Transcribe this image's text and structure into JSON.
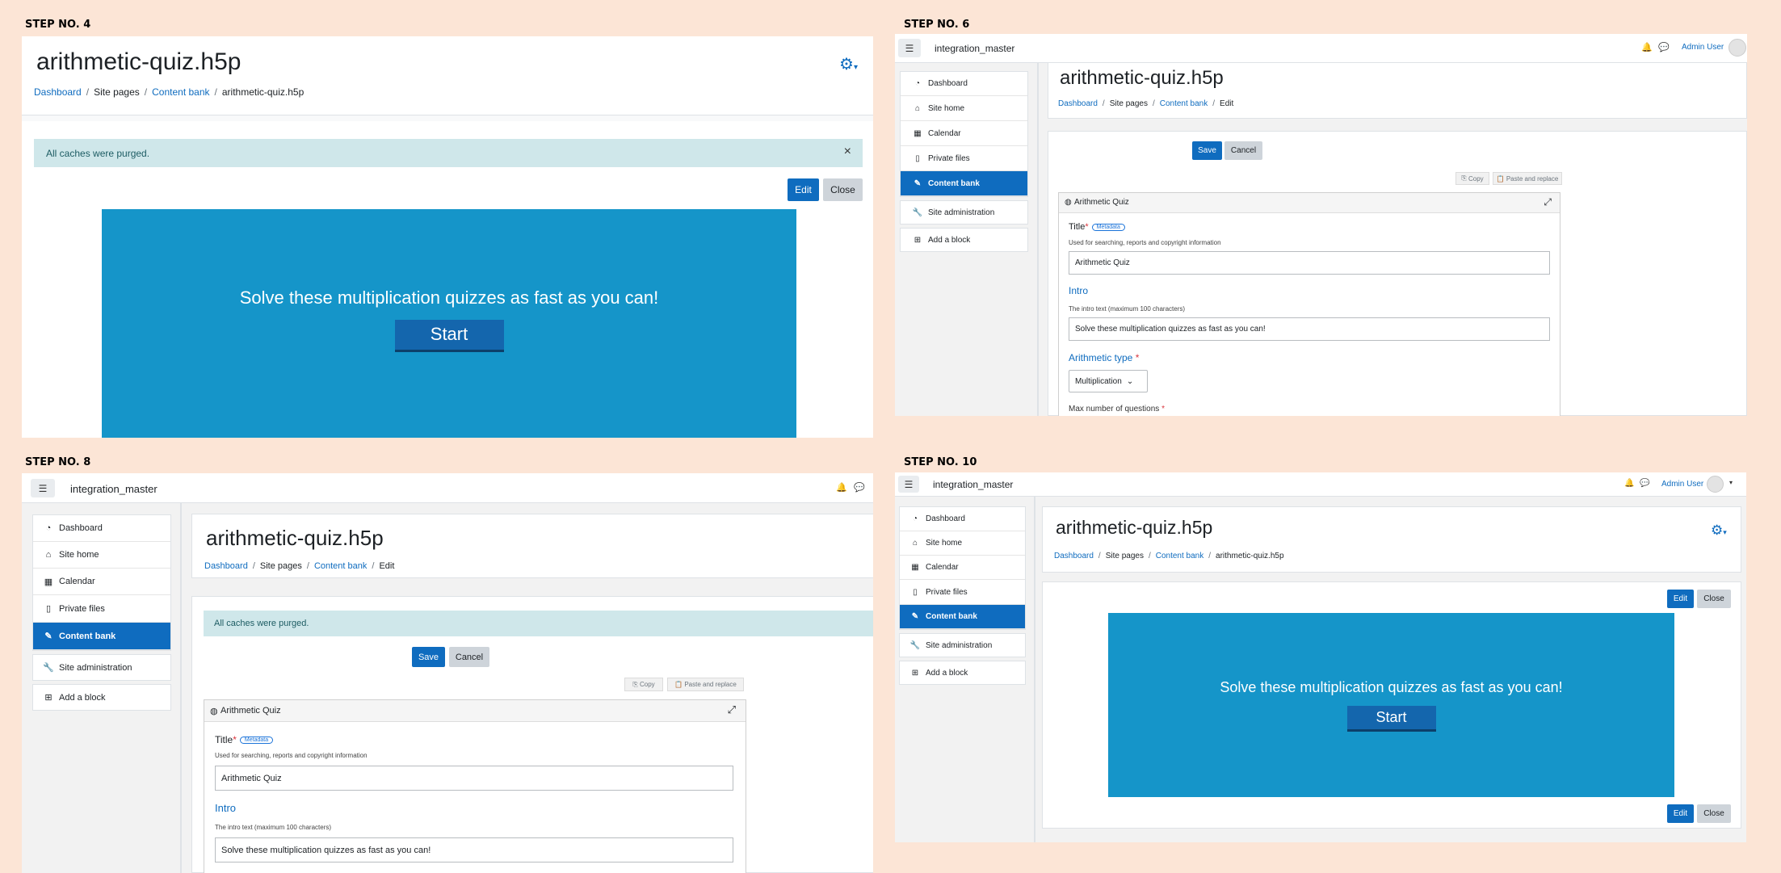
{
  "steps": [
    {
      "label": "STEP NO. 4"
    },
    {
      "label": "STEP NO. 6"
    },
    {
      "label": "STEP NO. 8"
    },
    {
      "label": "STEP NO. 10"
    }
  ],
  "common": {
    "site_name": "integration_master",
    "user_name": "Admin User",
    "page_title": "arithmetic-quiz.h5p",
    "breadcrumb_view": [
      "Dashboard",
      "Site pages",
      "Content bank",
      "arithmetic-quiz.h5p"
    ],
    "breadcrumb_edit": [
      "Dashboard",
      "Site pages",
      "Content bank",
      "Edit"
    ],
    "alert": "All caches were purged.",
    "close_symbol": "×",
    "edit_label": "Edit",
    "close_label": "Close",
    "save_label": "Save",
    "cancel_label": "Cancel",
    "copy_label": "Copy",
    "paste_label": "Paste and replace",
    "h5p_text": "Solve these multiplication quizzes as fast as you can!",
    "h5p_start": "Start",
    "nav": [
      "Dashboard",
      "Site home",
      "Calendar",
      "Private files",
      "Content bank",
      "Site administration",
      "Add a block"
    ],
    "nav_active_index": 4,
    "editor": {
      "header": "Arithmetic Quiz",
      "title_label": "Title",
      "metadata_badge": "Metadata",
      "title_desc": "Used for searching, reports and copyright information",
      "title_value": "Arithmetic Quiz",
      "intro_label": "Intro",
      "intro_desc": "The intro text (maximum 100 characters)",
      "intro_value": "Solve these multiplication quizzes as fast as you can!",
      "arith_label": "Arithmetic type",
      "arith_value": "Multiplication",
      "max_q_label": "Max number of questions"
    }
  },
  "colors": {
    "background": "#fce5d6",
    "primary": "#0f6cbf",
    "h5p_bg": "#1595c9",
    "alert_bg": "#cfe7ea"
  },
  "icons": [
    "gear-icon",
    "bell-icon",
    "chat-icon",
    "hamburger-icon",
    "expand-icon",
    "avatar",
    "close-icon"
  ]
}
